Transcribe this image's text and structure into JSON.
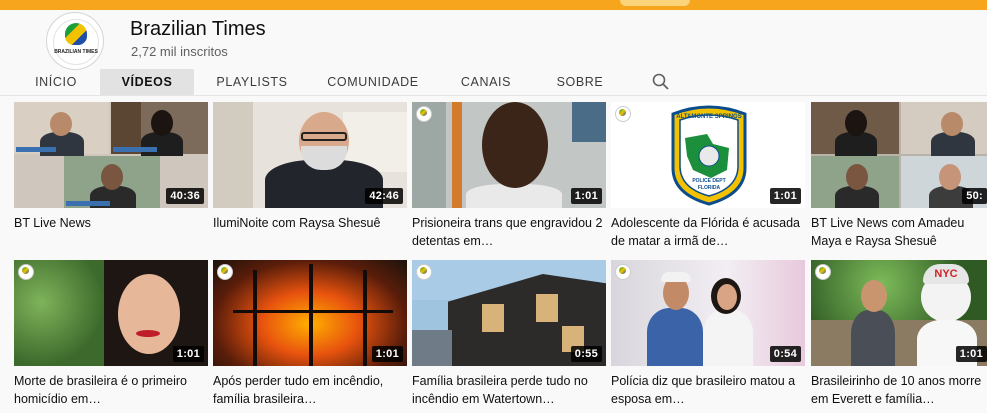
{
  "channel": {
    "name": "Brazilian Times",
    "subscribers": "2,72 mil inscritos",
    "avatar_wordmark": "BRAZILIAN TIMES"
  },
  "tabs": [
    {
      "label": "INÍCIO",
      "active": false
    },
    {
      "label": "VÍDEOS",
      "active": true
    },
    {
      "label": "PLAYLISTS",
      "active": false
    },
    {
      "label": "COMUNIDADE",
      "active": false
    },
    {
      "label": "CANAIS",
      "active": false
    },
    {
      "label": "SOBRE",
      "active": false
    }
  ],
  "search_icon": "search-icon",
  "videos": [
    {
      "title": "BT Live News",
      "duration": "40:36"
    },
    {
      "title": "IlumiNoite com Raysa Shesuê",
      "duration": "42:46"
    },
    {
      "title": "Prisioneira trans que engravidou 2 detentas em…",
      "duration": "1:01"
    },
    {
      "title": "Adolescente da Flórida é acusada de matar a irmã de…",
      "duration": "1:01"
    },
    {
      "title": "BT Live News com Amadeu Maya e Raysa Shesuê",
      "duration": "50:"
    },
    {
      "title": "Morte de brasileira é o primeiro homicídio em…",
      "duration": "1:01"
    },
    {
      "title": "Após perder tudo em incêndio, família brasileira…",
      "duration": "1:01"
    },
    {
      "title": "Família brasileira perde tudo no incêndio em Watertown…",
      "duration": "0:55"
    },
    {
      "title": "Polícia diz que brasileiro matou a esposa em…",
      "duration": "0:54"
    },
    {
      "title": "Brasileirinho de 10 anos morre em Everett e família…",
      "duration": "1:01"
    }
  ],
  "thumbnail_text": {
    "badge_line1": "ALTAMONTE SPRINGS",
    "badge_line2": "POLICE DEPT",
    "badge_line3": "FLORIDA",
    "mascot_cap": "NYC"
  },
  "colors": {
    "banner": "#f7a51c",
    "active_tab_bg": "#e2e2e2",
    "duration_bg": "#000000"
  }
}
